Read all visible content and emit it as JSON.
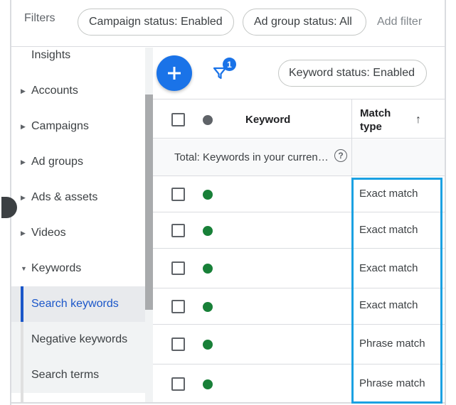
{
  "filter_bar": {
    "label": "Filters",
    "chips": [
      "Campaign status: Enabled",
      "Ad group status: All"
    ],
    "add_filter": "Add filter"
  },
  "sidebar": {
    "items": [
      {
        "label": "Insights",
        "caret": ""
      },
      {
        "label": "Accounts",
        "caret": "▶"
      },
      {
        "label": "Campaigns",
        "caret": "▶"
      },
      {
        "label": "Ad groups",
        "caret": "▶"
      },
      {
        "label": "Ads & assets",
        "caret": "▶"
      },
      {
        "label": "Videos",
        "caret": "▶"
      },
      {
        "label": "Keywords",
        "caret": "▼"
      }
    ],
    "sub_items": [
      {
        "label": "Search keywords",
        "active": true
      },
      {
        "label": "Negative keywords",
        "active": false
      },
      {
        "label": "Search terms",
        "active": false
      }
    ]
  },
  "toolbar": {
    "add_icon": "plus-icon",
    "filter_icon": "filter-funnel-icon",
    "filter_badge": "1",
    "keyword_chip": "Keyword status: Enabled"
  },
  "table": {
    "headers": {
      "keyword": "Keyword",
      "match_type_line1": "Match",
      "match_type_line2": "type",
      "sort_indicator": "↑"
    },
    "total_label": "Total: Keywords in your curren…",
    "help_icon": "?",
    "rows": [
      {
        "keyword": "",
        "status": "enabled",
        "match_type": "Exact match"
      },
      {
        "keyword": "",
        "status": "enabled",
        "match_type": "Exact match"
      },
      {
        "keyword": "",
        "status": "enabled",
        "match_type": "Exact match"
      },
      {
        "keyword": "",
        "status": "enabled",
        "match_type": "Exact match"
      },
      {
        "keyword": "",
        "status": "enabled",
        "match_type": "Phrase match"
      },
      {
        "keyword": "",
        "status": "enabled",
        "match_type": "Phrase match"
      }
    ]
  },
  "colors": {
    "accent": "#1a73e8",
    "active_nav": "#1a56c9",
    "status_enabled": "#188038",
    "highlight_box": "#1ba1e2"
  }
}
